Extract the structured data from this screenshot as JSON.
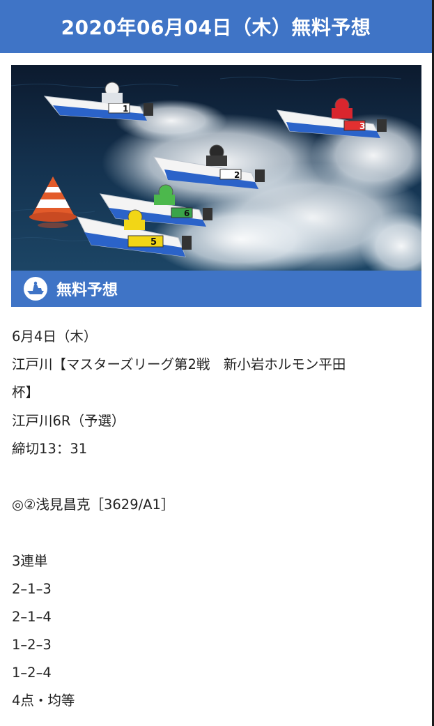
{
  "header": {
    "title": "2020年06月04日（木）無料予想"
  },
  "hero_image": {
    "description_icon": "boat-race-photo",
    "boat_labels": [
      "1",
      "2",
      "3",
      "5",
      "6"
    ]
  },
  "section": {
    "icon": "boat-icon",
    "title": "無料予想"
  },
  "content": {
    "date_line": "6月4日（木）",
    "race_title_line1": "江戸川【マスターズリーグ第2戦　新小岩ホルモン平田",
    "race_title_line2": "杯】",
    "race_line": "江戸川6R（予選）",
    "deadline_line": "締切13：31",
    "pick_line": "◎②浅見昌克［3629/A1］",
    "bet_type": "3連単",
    "bets": [
      "2–1–3",
      "2–1–4",
      "1–2–3",
      "1–2–4"
    ],
    "summary": "4点・均等"
  },
  "colors": {
    "accent": "#3f74c6",
    "text": "#222222"
  }
}
